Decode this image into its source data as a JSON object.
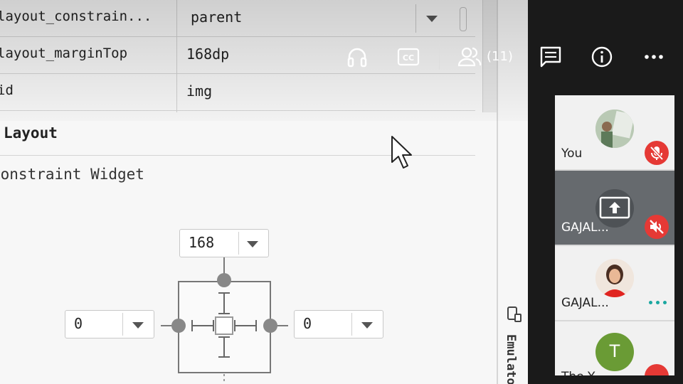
{
  "attributes": [
    {
      "name": "layout_constrain...",
      "value": "parent"
    },
    {
      "name": "layout_marginTop",
      "value": "168dp"
    },
    {
      "name": "id",
      "value": "img"
    }
  ],
  "section_title": "Layout",
  "widget_title": "Constraint Widget",
  "margins": {
    "top": "168",
    "left": "0",
    "right": "0"
  },
  "emulator_label": "Emulator",
  "topbar": {
    "participants_count": "(11)"
  },
  "participants": [
    {
      "name": "You",
      "mic": "muted"
    },
    {
      "name": "GAJAL...",
      "mic": "muted",
      "presenting": true
    },
    {
      "name": "GAJAL...",
      "mic": "on"
    },
    {
      "name": "The Y...",
      "initial": "T",
      "avatar_color": "#6a9b35",
      "mic": "muted"
    }
  ],
  "colors": {
    "accent_red": "#e53935",
    "teal": "#1aa7a0",
    "panel_bg": "#f1f1f1",
    "active_tile": "#666a6e"
  },
  "icons": [
    "headphones-icon",
    "closed-caption-icon",
    "people-icon",
    "chat-icon",
    "info-icon",
    "more-icon",
    "mic-off-icon",
    "volume-off-icon",
    "present-screen-icon",
    "cursor-icon",
    "emulator-icon"
  ]
}
